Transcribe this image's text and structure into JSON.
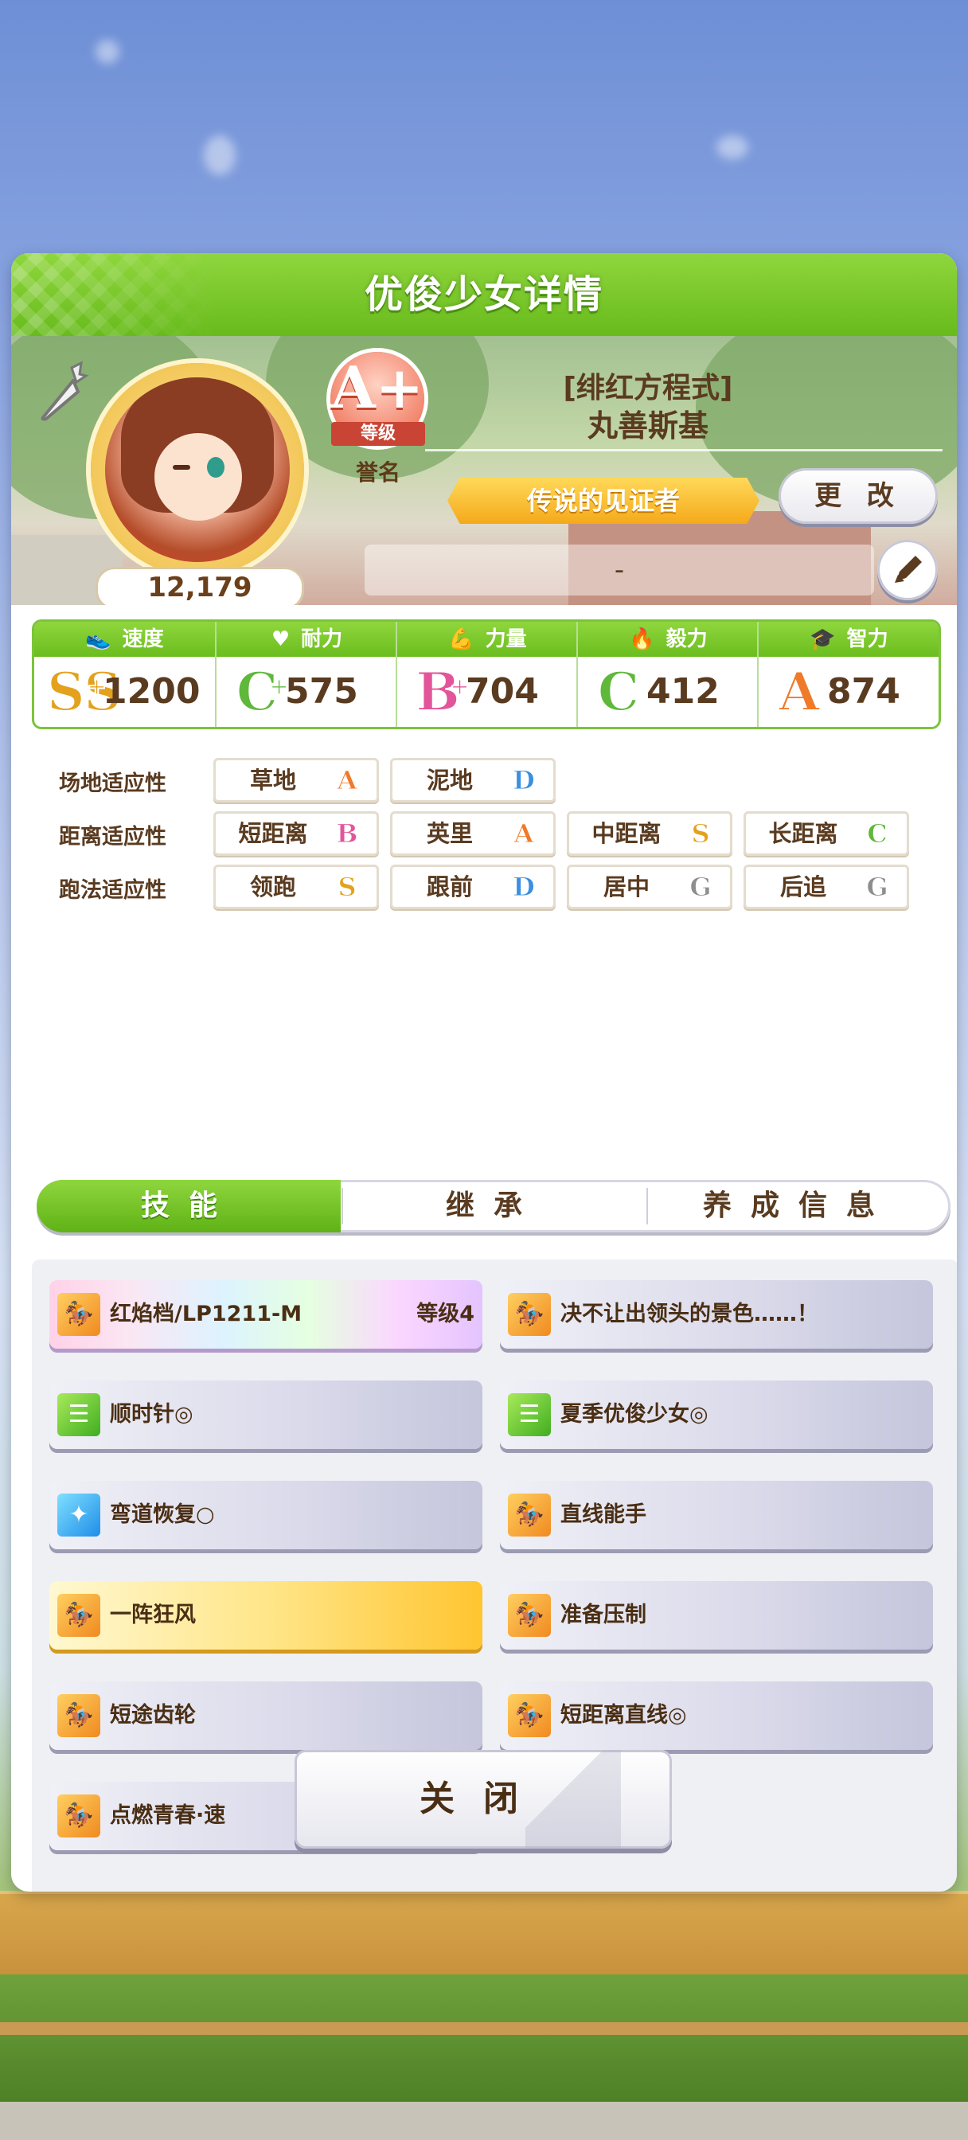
{
  "panel": {
    "title": "优俊少女详情"
  },
  "profile": {
    "score": "12,179",
    "rank": {
      "letter": "A+",
      "ribbon": "等级",
      "fame": "誉名"
    },
    "nickname": "[绯红方程式]",
    "name": "丸善斯基",
    "title": "传说的见证者",
    "change_label": "更 改",
    "comment": "-"
  },
  "stats": [
    {
      "label": "速度",
      "icon": "shoe-icon",
      "grade": "SS",
      "plus": "+",
      "grade_color": "#e3a11c",
      "value": "1200"
    },
    {
      "label": "耐力",
      "icon": "heart-icon",
      "grade": "C",
      "plus": "+",
      "grade_color": "#5fb83a",
      "value": "575"
    },
    {
      "label": "力量",
      "icon": "muscle-icon",
      "grade": "B",
      "plus": "+",
      "grade_color": "#e3559a",
      "value": "704"
    },
    {
      "label": "毅力",
      "icon": "flame-icon",
      "grade": "C",
      "plus": "",
      "grade_color": "#5fb83a",
      "value": "412"
    },
    {
      "label": "智力",
      "icon": "graduation-cap-icon",
      "grade": "A",
      "plus": "",
      "grade_color": "#ef7a2a",
      "value": "874"
    }
  ],
  "aptitudes": {
    "track": {
      "label": "场地适应性",
      "items": [
        {
          "name": "草地",
          "grade": "A"
        },
        {
          "name": "泥地",
          "grade": "D"
        }
      ]
    },
    "distance": {
      "label": "距离适应性",
      "items": [
        {
          "name": "短距离",
          "grade": "B"
        },
        {
          "name": "英里",
          "grade": "A"
        },
        {
          "name": "中距离",
          "grade": "S"
        },
        {
          "name": "长距离",
          "grade": "C"
        }
      ]
    },
    "style": {
      "label": "跑法适应性",
      "items": [
        {
          "name": "领跑",
          "grade": "S"
        },
        {
          "name": "跟前",
          "grade": "D"
        },
        {
          "name": "居中",
          "grade": "G"
        },
        {
          "name": "后追",
          "grade": "G"
        }
      ]
    }
  },
  "grade_colors": {
    "A": "#ef7a2a",
    "B": "#e3559a",
    "C": "#5fb83a",
    "D": "#3a8fe0",
    "S": "#e3a11c",
    "G": "#8e8e8e"
  },
  "tabs": [
    {
      "label": "技能",
      "active": true
    },
    {
      "label": "继承",
      "active": false
    },
    {
      "label": "养成信息",
      "active": false
    }
  ],
  "skills": [
    {
      "name": "红焰档/LP1211-M",
      "level": "等级4",
      "style": "rainbow",
      "icon": "running-horse-icon",
      "icon_color": "orange"
    },
    {
      "name": "决不让出领头的景色……！",
      "level": "",
      "style": "normal",
      "icon": "running-horse-icon",
      "icon_color": "orange"
    },
    {
      "name": "顺时针◎",
      "level": "",
      "style": "normal",
      "icon": "document-icon",
      "icon_color": "green"
    },
    {
      "name": "夏季优俊少女◎",
      "level": "",
      "style": "normal",
      "icon": "document-icon",
      "icon_color": "green"
    },
    {
      "name": "弯道恢复○",
      "level": "",
      "style": "normal",
      "icon": "sparkle-icon",
      "icon_color": "blue"
    },
    {
      "name": "直线能手",
      "level": "",
      "style": "normal",
      "icon": "running-horse-icon",
      "icon_color": "orange"
    },
    {
      "name": "一阵狂风",
      "level": "",
      "style": "gold",
      "icon": "running-horse-icon",
      "icon_color": "orange"
    },
    {
      "name": "准备压制",
      "level": "",
      "style": "normal",
      "icon": "running-horse-icon",
      "icon_color": "orange"
    },
    {
      "name": "短途齿轮",
      "level": "",
      "style": "normal",
      "icon": "running-horse-icon",
      "icon_color": "orange"
    },
    {
      "name": "短距离直线◎",
      "level": "",
      "style": "normal",
      "icon": "running-horse-icon",
      "icon_color": "orange"
    },
    {
      "name": "点燃青春·速",
      "level": "",
      "style": "normal",
      "icon": "running-horse-icon",
      "icon_color": "orange"
    }
  ],
  "close_label": "关闭"
}
